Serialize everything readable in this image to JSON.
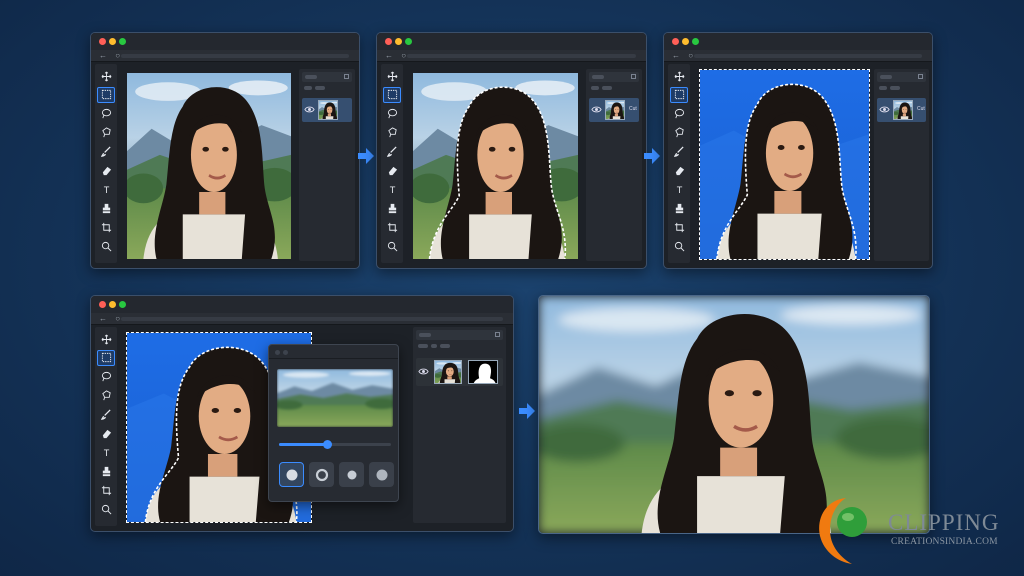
{
  "windows": [
    {
      "id": "step1",
      "layer_label": ""
    },
    {
      "id": "step2",
      "layer_label": "Cut"
    },
    {
      "id": "step3",
      "layer_label": "Cut"
    },
    {
      "id": "step4",
      "layer_label": ""
    }
  ],
  "tools": [
    "move-tool",
    "marquee-tool",
    "lasso-tool",
    "polygon-lasso-tool",
    "brush-tool",
    "eraser-tool",
    "text-tool",
    "stamp-tool",
    "crop-tool",
    "zoom-tool"
  ],
  "tool_text_glyph": "T",
  "menubar_nav": "← ○",
  "blur_dialog": {
    "slider_level": 0.43,
    "blur_options": [
      "lens-blur",
      "field-blur",
      "gaussian-blur",
      "soft-blur"
    ],
    "selected_option": 0
  },
  "brand": {
    "name": "CLIPPING",
    "sub": "CREATIONSINDIA.COM"
  },
  "colors": {
    "accent": "#3b8cff",
    "selection_bg": "#1f6fe6",
    "background": "#143358"
  }
}
